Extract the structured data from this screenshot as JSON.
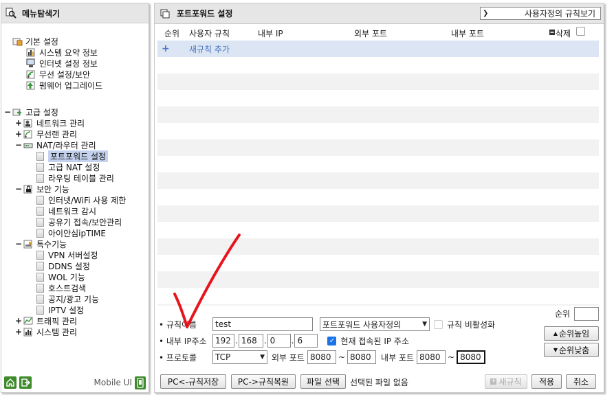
{
  "left": {
    "title": "메뉴탐색기",
    "tree": [
      {
        "label": "기본 설정",
        "toggle": ""
      },
      {
        "label": "시스템 요약 정보"
      },
      {
        "label": "인터넷 설정 정보"
      },
      {
        "label": "무선 설정/보안"
      },
      {
        "label": "펌웨어 업그레이드"
      },
      {
        "label": "고급 설정",
        "toggle": "−"
      },
      {
        "label": "네트워크 관리",
        "toggle": "+"
      },
      {
        "label": "무선랜 관리",
        "toggle": "+"
      },
      {
        "label": "NAT/라우터 관리",
        "toggle": "−"
      },
      {
        "label": "포트포워드 설정",
        "selected": true
      },
      {
        "label": "고급 NAT 설정"
      },
      {
        "label": "라우팅 테이블 관리"
      },
      {
        "label": "보안 기능",
        "toggle": "−"
      },
      {
        "label": "인터넷/WiFi 사용 제한"
      },
      {
        "label": "네트워크 감시"
      },
      {
        "label": "공유기 접속/보안관리"
      },
      {
        "label": "아이안심ipTIME"
      },
      {
        "label": "특수기능",
        "toggle": "−"
      },
      {
        "label": "VPN 서버설정"
      },
      {
        "label": "DDNS 설정"
      },
      {
        "label": "WOL 기능"
      },
      {
        "label": "호스트검색"
      },
      {
        "label": "공지/광고 기능"
      },
      {
        "label": "IPTV 설정"
      },
      {
        "label": "트래픽 관리",
        "toggle": "+"
      },
      {
        "label": "시스템 관리",
        "toggle": "+"
      }
    ],
    "mobile_label": "Mobile UI"
  },
  "main": {
    "title": "포트포워드 설정",
    "rule_view": "사용자정의 규칙보기",
    "columns": {
      "order": "순위",
      "user_rule": "사용자 규칙",
      "internal_ip": "내부 IP",
      "external_port": "외부 포트",
      "internal_port": "내부 포트",
      "delete": "삭제"
    },
    "add_plus": "+",
    "add_rule": "새규칙 추가",
    "form": {
      "rule_name_label": "규칙이름",
      "rule_name_value": "test",
      "rule_type": "포트포워드 사용자정의",
      "disable_label": "규칙 비활성화",
      "ip_label": "내부 IP주소",
      "ip": [
        "192",
        "168",
        "0",
        "6"
      ],
      "current_ip_label": "현재 접속된 IP 주소",
      "protocol_label": "프로토콜",
      "protocol": "TCP",
      "ext_port_label": "외부 포트",
      "ext_port_from": "8080",
      "ext_port_to": "8080",
      "int_port_label": "내부 포트",
      "int_port_from": "8080",
      "int_port_to": "8080",
      "tilde": "~",
      "order_label": "순위",
      "order_up": "순위높임",
      "order_down": "순위낮춤"
    },
    "bottom": {
      "save": "PC<-규칙저장",
      "restore": "PC->규칙복원",
      "file_select": "파일 선택",
      "no_file": "선택된 파일 없음",
      "new_rule": "새규칙",
      "apply": "적용",
      "cancel": "취소"
    }
  },
  "colors": {
    "accent": "#4a76c2",
    "selection": "#c4d2ee",
    "annotation": "#e8141c",
    "green": "#3e8a2c"
  }
}
